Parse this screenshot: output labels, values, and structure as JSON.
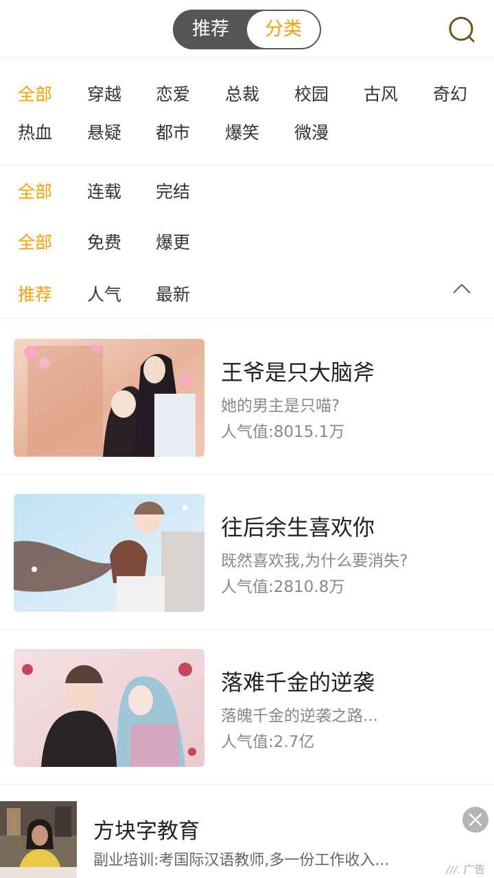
{
  "header": {
    "tab_recommend": "推荐",
    "tab_category": "分类",
    "search_icon": "search-icon"
  },
  "filters": {
    "genres": [
      "全部",
      "穿越",
      "恋爱",
      "总裁",
      "校园",
      "古风",
      "奇幻",
      "热血",
      "悬疑",
      "都市",
      "爆笑",
      "微漫"
    ],
    "status": [
      "全部",
      "连载",
      "完结"
    ],
    "price": [
      "全部",
      "免费",
      "爆更"
    ],
    "sort": [
      "推荐",
      "人气",
      "最新"
    ],
    "collapse_icon": "chevron-up-icon"
  },
  "comics": [
    {
      "title": "王爷是只大脑斧",
      "desc": "她的男主是只喵?",
      "popularity": "人气值:8015.1万"
    },
    {
      "title": "往后余生喜欢你",
      "desc": "既然喜欢我,为什么要消失?",
      "popularity": "人气值:2810.8万"
    },
    {
      "title": "落难千金的逆袭",
      "desc": "落魄千金的逆袭之路...",
      "popularity": "人气值:2.7亿"
    }
  ],
  "ad": {
    "title": "方块字教育",
    "desc": "副业培训:考国际汉语教师,多一份工作收入...",
    "tag": "广告",
    "close_icon": "close-icon"
  },
  "colors": {
    "accent": "#f5a000",
    "toggle_bg": "#555555",
    "muted": "#888888"
  }
}
